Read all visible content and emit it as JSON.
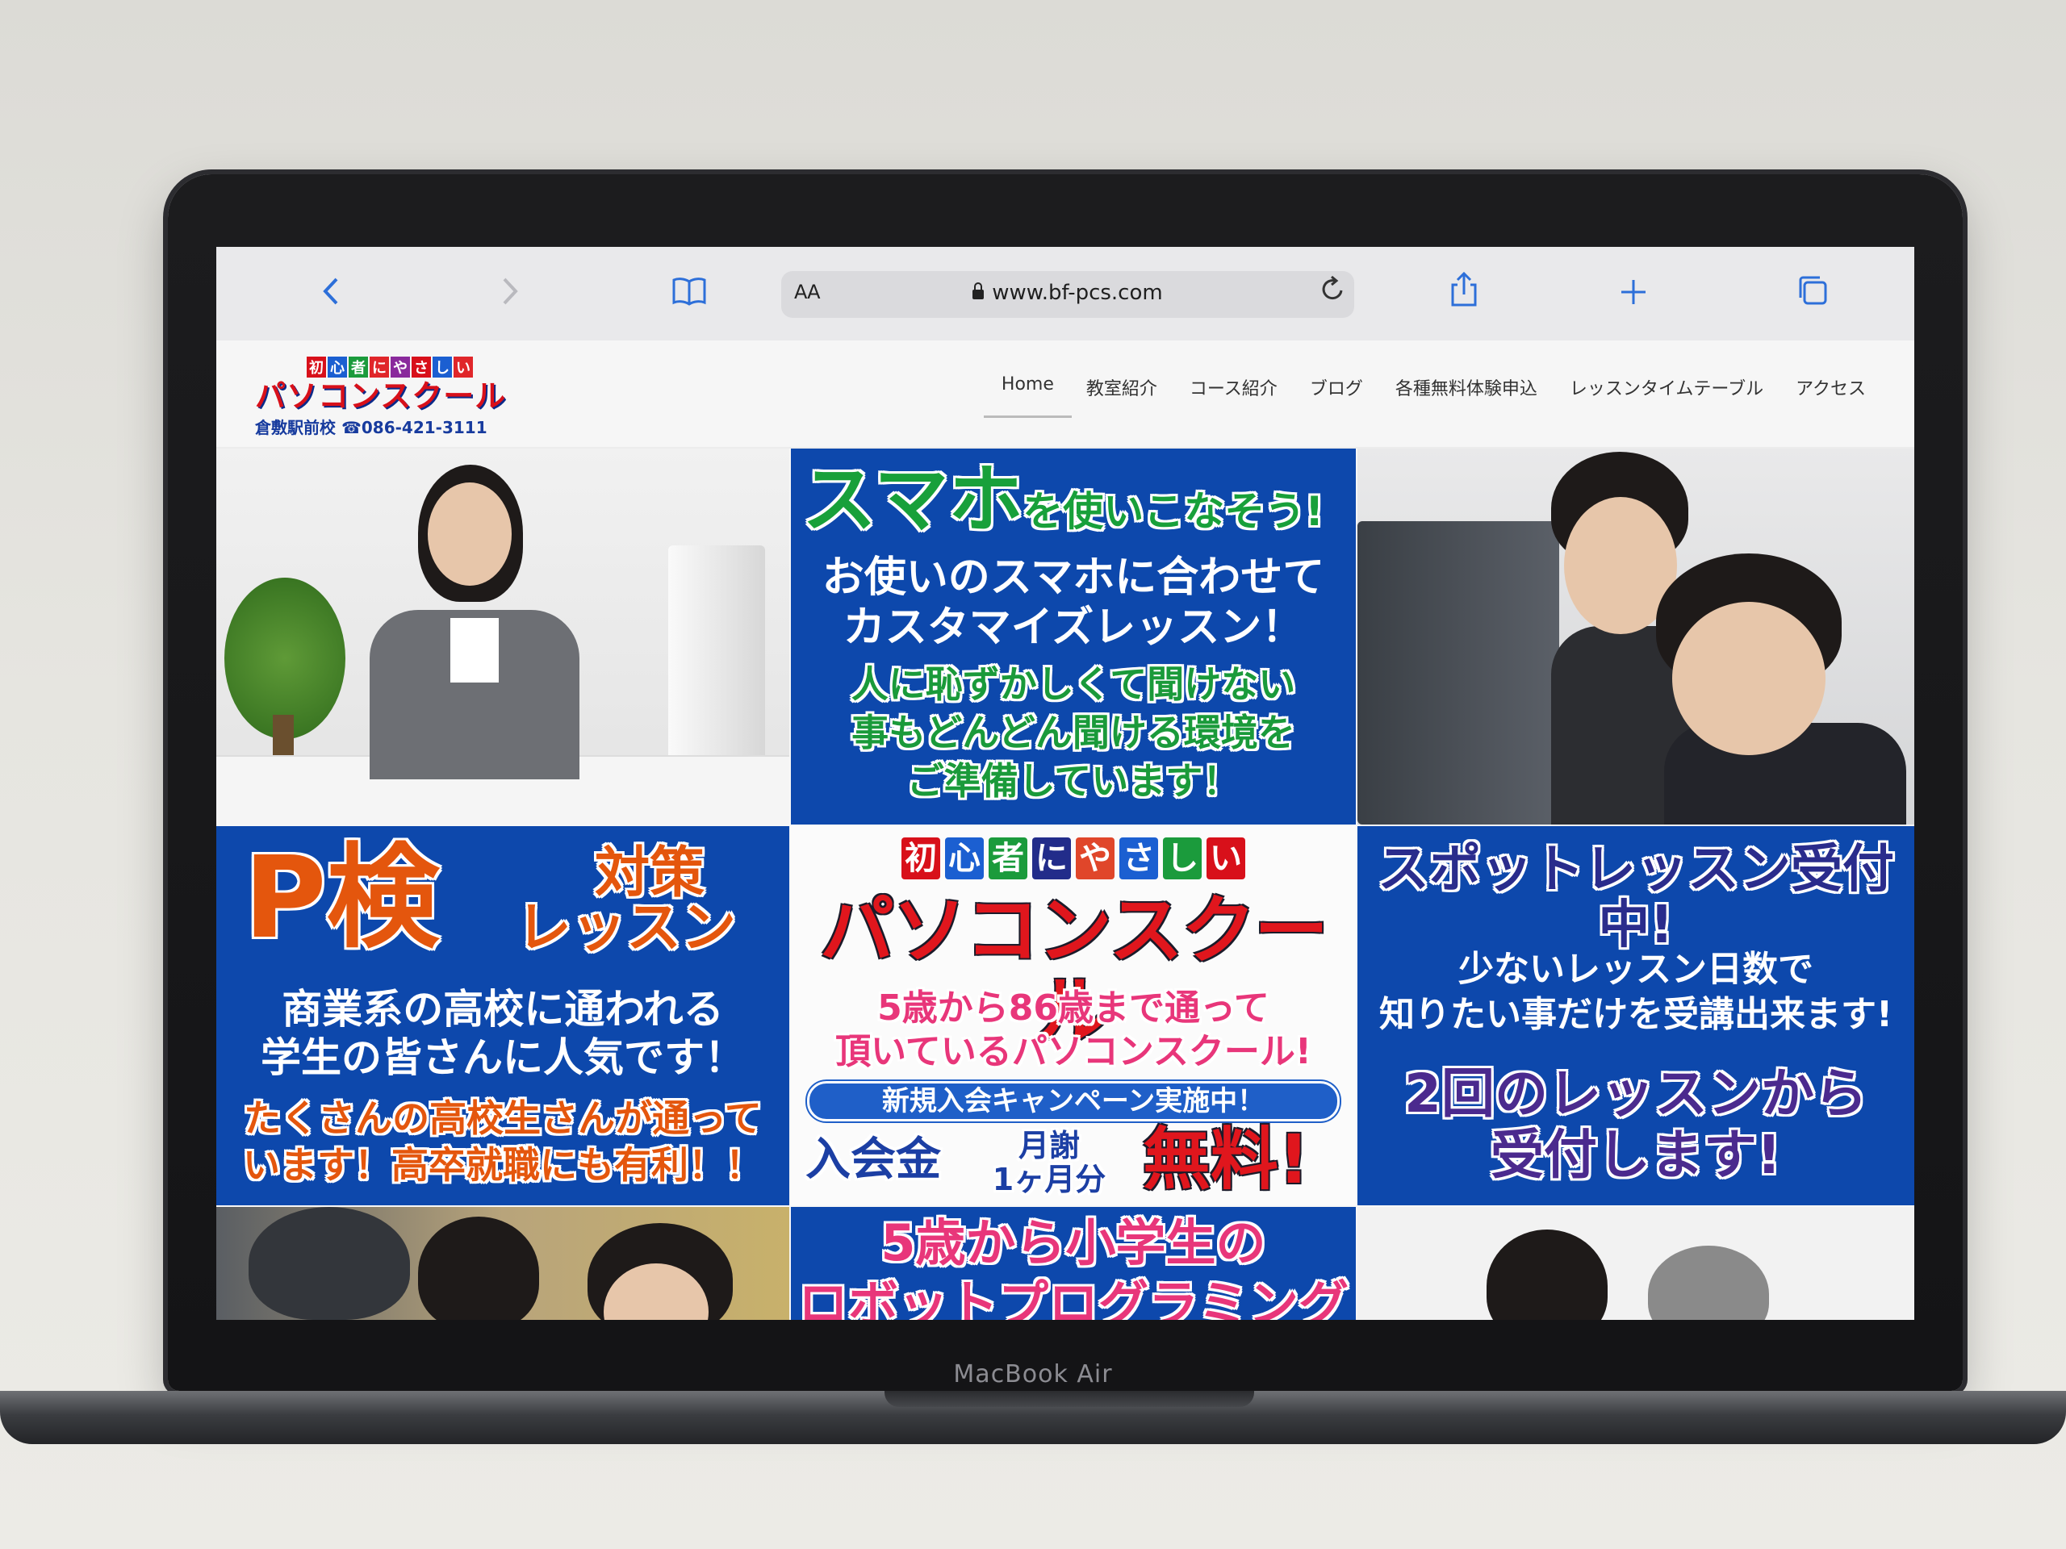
{
  "device": {
    "brand_label": "MacBook Air"
  },
  "browser": {
    "back_icon": "chevron-left-icon",
    "forward_icon": "chevron-right-icon",
    "bookmarks_icon": "book-icon",
    "text_size_label": "AA",
    "url": "www.bf-pcs.com",
    "reload_icon": "reload-icon",
    "share_icon": "share-icon",
    "new_tab_icon": "plus-icon",
    "tabs_icon": "tabs-icon"
  },
  "site": {
    "logo": {
      "tagline_chars": [
        "初",
        "心",
        "者",
        "に",
        "や",
        "さ",
        "し",
        "い"
      ],
      "tagline_colors": [
        "#d8101a",
        "#1b5fd1",
        "#1b9b3c",
        "#e0262a",
        "#8a2a9c",
        "#d8101a",
        "#1b5fd1",
        "#e0262a"
      ],
      "name": "パソコンスクール",
      "branch_phone": "倉敷駅前校 ☎086-421-3111"
    },
    "nav": [
      "Home",
      "教室紹介",
      "コース紹介",
      "ブログ",
      "各種無料体験申込",
      "レッスンタイムテーブル",
      "アクセス"
    ],
    "active_nav": "Home"
  },
  "hero": {
    "smartphone": {
      "title_main": "スマホ",
      "title_rest": "を使いこなそう!",
      "line1": "お使いのスマホに合わせて",
      "line2": "カスタマイズレッスン！",
      "line3": "人に恥ずかしくて聞けない",
      "line4": "事もどんどん聞ける環境を",
      "line5": "ご準備しています！"
    },
    "pken": {
      "title": "P検",
      "subtitle1": "対策",
      "subtitle2": "レッスン",
      "line1": "商業系の高校に通われる",
      "line2": "学生の皆さんに人気です！",
      "line3": "たくさんの高校生さんが通って",
      "line4": "います！高卒就職にも有利！！"
    },
    "center": {
      "kana": [
        "初",
        "心",
        "者",
        "に",
        "や",
        "さ",
        "し",
        "い"
      ],
      "kana_colors": [
        "#d8101a",
        "#1b5fd1",
        "#1b9b3c",
        "#222c8a",
        "#e0462a",
        "#1b5fd1",
        "#1b9b3c",
        "#d8101a"
      ],
      "title": "パソコンスクール",
      "line1": "5歳から86歳まで通って",
      "line2": "頂いているパソコンスクール!",
      "campaign": "新規入会キャンペーン実施中！",
      "fee_label": "入会金",
      "monthly_line1": "月謝",
      "monthly_line2": "1ヶ月分",
      "free_label": "無料!"
    },
    "spot": {
      "title": "スポットレッスン受付中!",
      "line1": "少ないレッスン日数で",
      "line2": "知りたい事だけを受講出来ます!",
      "line3": "2回のレッスンから",
      "line4": "受付します!"
    },
    "robot": {
      "line1": "5歳から小学生の",
      "line2": "ロボットプログラミング"
    }
  }
}
